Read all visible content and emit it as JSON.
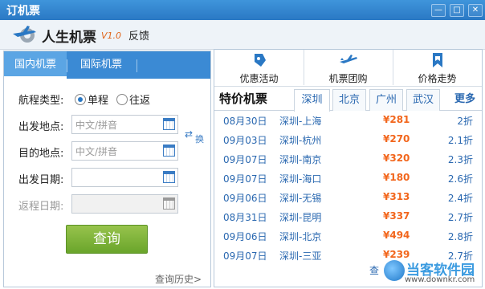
{
  "window": {
    "title": "订机票",
    "buttons": [
      "—",
      "□",
      "✕"
    ]
  },
  "brand": {
    "name": "人生机票",
    "version": "V1.0",
    "feedback": "反馈"
  },
  "left_tabs": [
    {
      "label": "国内机票",
      "active": true
    },
    {
      "label": "国际机票",
      "active": false
    }
  ],
  "form": {
    "trip_type_label": "航程类型:",
    "trip_options": [
      {
        "label": "单程",
        "selected": true
      },
      {
        "label": "往返",
        "selected": false
      }
    ],
    "from_label": "出发地点:",
    "from_placeholder": "中文/拼音",
    "to_label": "目的地点:",
    "to_placeholder": "中文/拼音",
    "depart_label": "出发日期:",
    "return_label": "返程日期:",
    "swap_label": "换",
    "search_button": "查询",
    "history_link": "查询历史>"
  },
  "toolbar": [
    {
      "label": "优惠活动",
      "icon": "coupon-icon"
    },
    {
      "label": "机票团购",
      "icon": "plane-icon"
    },
    {
      "label": "价格走势",
      "icon": "bookmark-icon"
    }
  ],
  "deals": {
    "title": "特价机票",
    "cities": [
      {
        "label": "深圳",
        "active": true
      },
      {
        "label": "北京",
        "active": false
      },
      {
        "label": "广州",
        "active": false
      },
      {
        "label": "武汉",
        "active": false
      }
    ],
    "more": "更多",
    "rows": [
      {
        "date": "08月30日",
        "route": "深圳-上海",
        "price": "¥281",
        "discount": "2折"
      },
      {
        "date": "09月03日",
        "route": "深圳-杭州",
        "price": "¥270",
        "discount": "2.1折"
      },
      {
        "date": "09月07日",
        "route": "深圳-南京",
        "price": "¥320",
        "discount": "2.3折"
      },
      {
        "date": "09月07日",
        "route": "深圳-海口",
        "price": "¥180",
        "discount": "2.6折"
      },
      {
        "date": "09月06日",
        "route": "深圳-无锡",
        "price": "¥313",
        "discount": "2.4折"
      },
      {
        "date": "08月31日",
        "route": "深圳-昆明",
        "price": "¥337",
        "discount": "2.7折"
      },
      {
        "date": "09月06日",
        "route": "深圳-北京",
        "price": "¥494",
        "discount": "2.8折"
      },
      {
        "date": "09月07日",
        "route": "深圳-三亚",
        "price": "¥239",
        "discount": "2.7折"
      }
    ]
  },
  "watermark": {
    "prefix": "查",
    "name": "当客软件园",
    "url": "www.downkr.com"
  },
  "colors": {
    "titlebar": "#2a78c4",
    "tab_bar": "#3b8ad4",
    "search_button": "#7cb236",
    "price": "#f2661c",
    "link": "#2a68b0"
  }
}
